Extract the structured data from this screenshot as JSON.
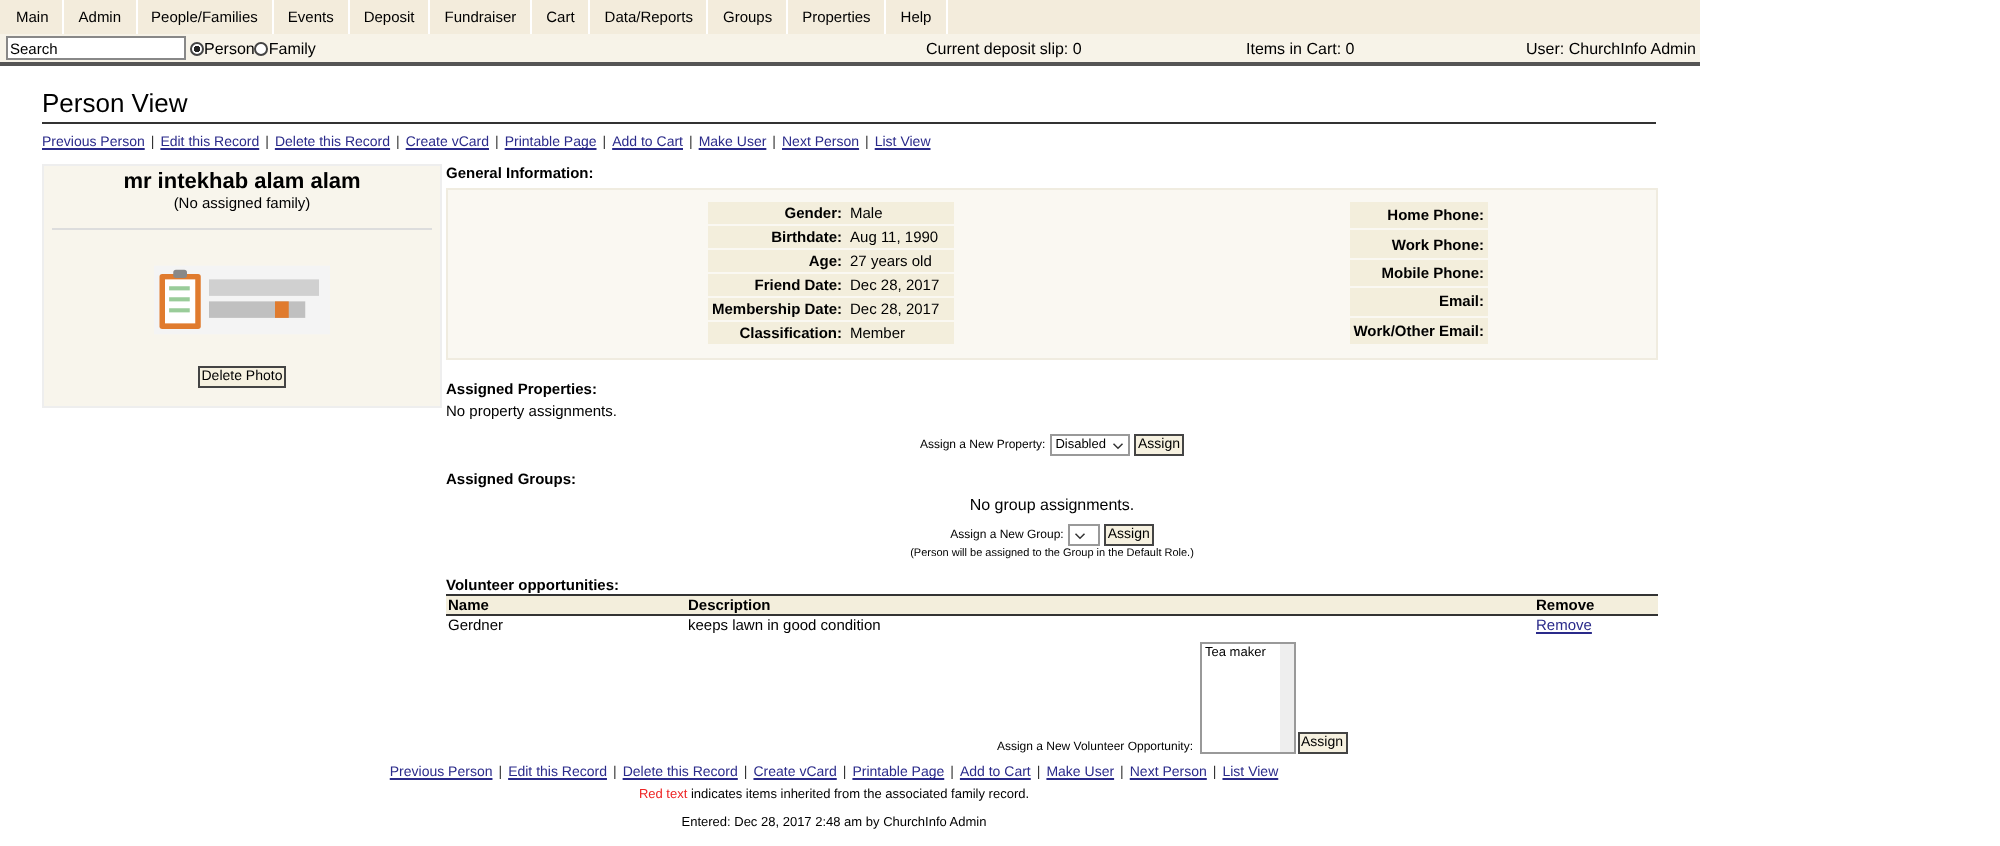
{
  "menu": [
    {
      "label": "Main"
    },
    {
      "label": "Admin"
    },
    {
      "label": "People/Families"
    },
    {
      "label": "Events"
    },
    {
      "label": "Deposit"
    },
    {
      "label": "Fundraiser"
    },
    {
      "label": "Cart"
    },
    {
      "label": "Data/Reports"
    },
    {
      "label": "Groups"
    },
    {
      "label": "Properties"
    },
    {
      "label": "Help"
    }
  ],
  "search": {
    "value": "Search",
    "options": [
      {
        "label": "Person",
        "selected": true
      },
      {
        "label": "Family",
        "selected": false
      }
    ]
  },
  "status": {
    "deposit": "Current deposit slip: 0",
    "cart": "Items in Cart: 0",
    "user": "User: ChurchInfo Admin"
  },
  "title": "Person View",
  "top_links": {
    "separator": "|",
    "items": [
      "Previous Person",
      "Edit this Record",
      "Delete this Record",
      "Create vCard",
      "Printable Page",
      "Add to Cart",
      "Make User",
      "Next Person",
      "List View"
    ]
  },
  "person": {
    "name": "mr intekhab alam alam",
    "family": "(No assigned family)",
    "delete_button": "Delete Photo"
  },
  "general": {
    "heading": "General Information:",
    "fields": [
      {
        "label": "Gender:",
        "value": "Male"
      },
      {
        "label": "Birthdate:",
        "value": "Aug 11, 1990"
      },
      {
        "label": "Age:",
        "value": "27 years old"
      },
      {
        "label": "Friend Date:",
        "value": "Dec 28, 2017"
      },
      {
        "label": "Membership Date:",
        "value": "Dec 28, 2017"
      },
      {
        "label": "Classification:",
        "value": "Member"
      }
    ],
    "contact": [
      {
        "label": "Home Phone:"
      },
      {
        "label": "Work Phone:"
      },
      {
        "label": "Mobile Phone:"
      },
      {
        "label": "Email:"
      },
      {
        "label": "Work/Other Email:"
      }
    ]
  },
  "properties": {
    "heading": "Assigned Properties:",
    "empty": "No property assignments.",
    "assign_label": "Assign a New Property:",
    "select_value": "Disabled",
    "button": "Assign"
  },
  "groups": {
    "heading": "Assigned Groups:",
    "empty": "No group assignments.",
    "assign_label": "Assign a New Group:",
    "button": "Assign",
    "note": "(Person will be assigned to the Group in the Default Role.)"
  },
  "volunteer": {
    "heading": "Volunteer opportunities:",
    "columns": [
      "Name",
      "Description",
      "Remove"
    ],
    "rows": [
      {
        "name": "Gerdner",
        "description": "keeps lawn in good condition",
        "action": "Remove"
      }
    ],
    "assign_label": "Assign a New Volunteer Opportunity:",
    "list_items": [
      "Tea maker"
    ],
    "button": "Assign"
  },
  "bottom_links": {
    "separator": "|",
    "items": [
      "Previous Person",
      "Edit this Record",
      "Delete this Record",
      "Create vCard",
      "Printable Page",
      "Add to Cart",
      "Make User",
      "Next Person",
      "List View"
    ]
  },
  "legend": {
    "highlight": "Red text",
    "rest": "indicates items inherited from the associated family record."
  },
  "entered": "Entered: Dec 28, 2017 2:48 am by ChurchInfo Admin"
}
